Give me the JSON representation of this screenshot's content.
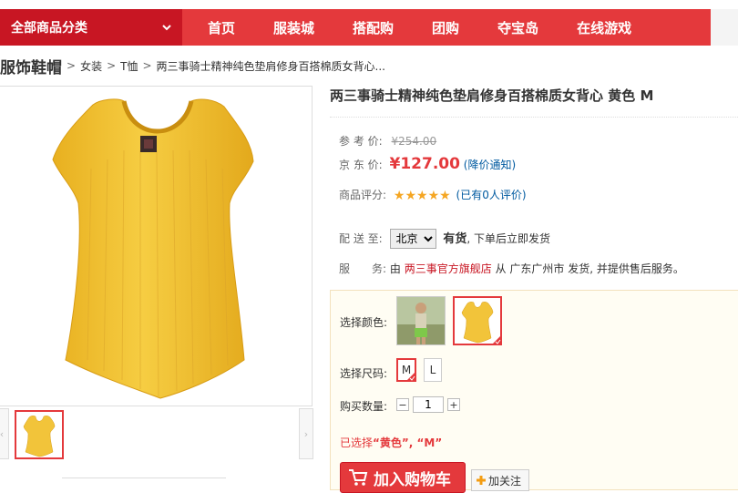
{
  "nav": {
    "category": "全部商品分类",
    "items": [
      "首页",
      "服装城",
      "搭配购",
      "团购",
      "夺宝岛",
      "在线游戏"
    ]
  },
  "breadcrumb": {
    "root": "服饰鞋帽",
    "items": [
      "女装",
      "T恤",
      "两三事骑士精神纯色垫肩修身百搭棉质女背心..."
    ]
  },
  "product": {
    "title": "两三事骑士精神纯色垫肩修身百搭棉质女背心 黄色 M",
    "ref_price_label": "参 考 价:",
    "ref_price": "¥254.00",
    "jd_price_label": "京 东 价:",
    "jd_price": "¥127.00",
    "price_notice": "(降价通知)",
    "rating_label": "商品评分:",
    "rating_stars": 5,
    "rating_text": "(已有0人评价)",
    "delivery_label": "配 送 至:",
    "city": "北京",
    "stock": "有货",
    "stock_note": ", 下单后立即发货",
    "service_label": "服　　务:",
    "service_prefix": "由",
    "shop": "两三事官方旗舰店",
    "service_from": "从 广东广州市 发货, 并提供售后服务。"
  },
  "choose": {
    "color_label": "选择颜色:",
    "size_label": "选择尺码:",
    "sizes": [
      "M",
      "L"
    ],
    "qty_label": "购买数量:",
    "qty": "1",
    "minus": "−",
    "plus": "+",
    "selected_prefix": "已选择",
    "selected_value": "“黄色”, “M”",
    "cart_label": "加入购物车",
    "follow_label": "加关注"
  },
  "colors": {
    "accent": "#e4393c",
    "shirt": "#f0c030"
  }
}
